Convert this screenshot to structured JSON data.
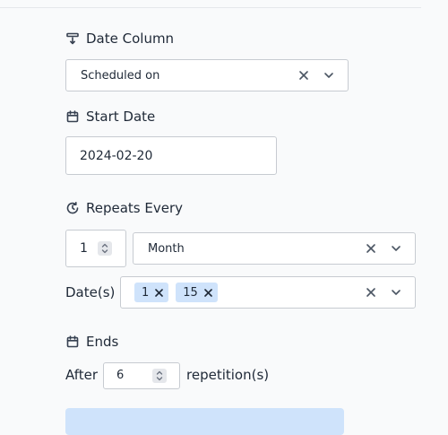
{
  "date_column": {
    "label": "Date Column",
    "icon": "filter-down-icon",
    "selected": "Scheduled on"
  },
  "start_date": {
    "label": "Start Date",
    "icon": "calendar-icon",
    "value": "2024-02-20"
  },
  "repeats_every": {
    "label": "Repeats Every",
    "icon": "refresh-clock-icon",
    "interval": "1",
    "unit": "Month"
  },
  "dates": {
    "label": "Date(s)",
    "tags": [
      "1",
      "15"
    ]
  },
  "ends": {
    "label": "Ends",
    "icon": "calendar-icon",
    "prefix": "After",
    "count": "6",
    "suffix": "repetition(s)"
  },
  "colors": {
    "tag_bg": "#cfe3fb",
    "border": "#c7cbd1",
    "page_bg": "#f9fafb"
  }
}
